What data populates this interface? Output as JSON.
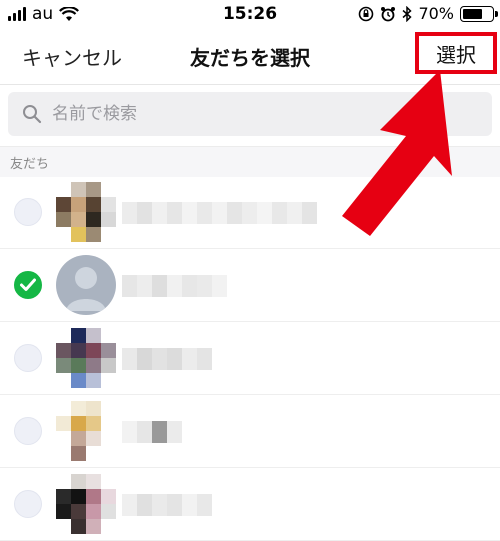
{
  "status_bar": {
    "carrier": "au",
    "time": "15:26",
    "battery_percent": "70%",
    "battery_level": 0.7
  },
  "nav": {
    "cancel_label": "キャンセル",
    "title": "友だちを選択",
    "select_label": "選択"
  },
  "search": {
    "placeholder": "名前で検索"
  },
  "section": {
    "label": "友だち"
  },
  "friends": [
    {
      "checked": false,
      "avatar": "pixelated-photo"
    },
    {
      "checked": true,
      "avatar": "default-person"
    },
    {
      "checked": false,
      "avatar": "pixelated-photo"
    },
    {
      "checked": false,
      "avatar": "pixelated-photo"
    },
    {
      "checked": false,
      "avatar": "pixelated-photo"
    }
  ],
  "colors": {
    "highlight_red": "#e60012",
    "check_green": "#15b745",
    "search_bg": "#efeff1"
  },
  "icons": [
    "signal-icon",
    "wifi-icon",
    "rotation-lock-icon",
    "alarm-icon",
    "bluetooth-icon",
    "battery-icon",
    "search-icon",
    "checkmark-icon",
    "arrow-annotation-icon"
  ]
}
